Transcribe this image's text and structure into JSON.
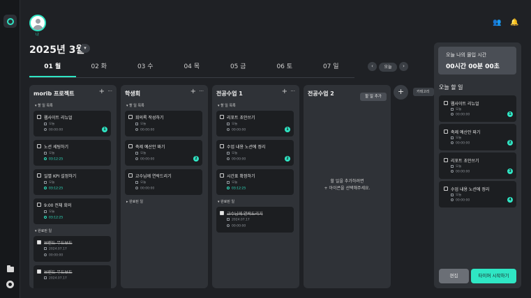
{
  "header": {
    "user_label": "나",
    "month_title": "2025년 3월",
    "month_dropdown_icon": "chevron-down-icon",
    "friends_icon": "users-icon",
    "notification_icon": "bell-icon"
  },
  "week": {
    "days": [
      "01 월",
      "02 화",
      "03 수",
      "04 목",
      "05 금",
      "06 토",
      "07 일"
    ],
    "active_index": 0,
    "prev_icon": "chevron-left-icon",
    "next_icon": "chevron-right-icon",
    "today_label": "오늘"
  },
  "columns": [
    {
      "title": "morib 프로젝트",
      "todo_header": "할 일 목록",
      "todo": [
        {
          "title": "웹사이트 리뉴얼",
          "deadline": "오늘",
          "time": "00:00:00",
          "badge": "1",
          "timer_active": false
        },
        {
          "title": "노션 세팅하기",
          "deadline": "오늘",
          "time": "03:12:25",
          "badge": "",
          "timer_active": true
        },
        {
          "title": "일별 KPI 설정하기",
          "deadline": "오늘",
          "time": "03:12:25",
          "badge": "",
          "timer_active": true
        },
        {
          "title": "9:00 전체 회의",
          "deadline": "오늘",
          "time": "03:12:25",
          "badge": "",
          "timer_active": true
        }
      ],
      "done_header": "완료된 일",
      "done": [
        {
          "title": "브랜드 무드보드",
          "deadline": "2024.07.17",
          "time": "00:00:00"
        },
        {
          "title": "브랜드 무드보드",
          "deadline": "2024.07.17",
          "time": ""
        }
      ]
    },
    {
      "title": "학생회",
      "todo_header": "할 일 목록",
      "todo": [
        {
          "title": "회의록 작성하기",
          "deadline": "오늘",
          "time": "00:00:00",
          "badge": "",
          "timer_active": false
        },
        {
          "title": "축제 예산안 짜기",
          "deadline": "오늘",
          "time": "00:00:00",
          "badge": "2",
          "timer_active": false
        },
        {
          "title": "교수님께 연락드리기",
          "deadline": "오늘",
          "time": "00:00:00",
          "badge": "",
          "timer_active": false
        }
      ],
      "done_header": "완료된 일",
      "done": []
    },
    {
      "title": "전공수업 1",
      "todo_header": "할 일 목록",
      "todo": [
        {
          "title": "리포트 초안쓰기",
          "deadline": "오늘",
          "time": "00:00:00",
          "badge": "1",
          "timer_active": false
        },
        {
          "title": "수업 내용 노션에 정리",
          "deadline": "오늘",
          "time": "00:00:00",
          "badge": "2",
          "timer_active": false
        },
        {
          "title": "시간표 확정하기",
          "deadline": "오늘",
          "time": "03:12:25",
          "badge": "",
          "timer_active": true
        }
      ],
      "done_header": "완료된 일",
      "done": [
        {
          "title": "교수님께 연락드리기",
          "deadline": "2024.07.17",
          "time": "00:00:00"
        }
      ]
    },
    {
      "title": "전공수업 2",
      "add_task_label": "할 일 추가",
      "empty_line1": "할 일을 추가하려면",
      "empty_line2": "+ 아이콘을 선택해주세요."
    }
  ],
  "add_category_tooltip": "카테고리",
  "panel": {
    "focus_label": "오늘 나의 몰입 시간",
    "focus_value": "00시간 00분 00초",
    "today_title": "오늘 할 일",
    "items": [
      {
        "title": "웹사이트 리뉴얼",
        "deadline": "오늘",
        "time": "00:00:00",
        "badge": "1"
      },
      {
        "title": "축제 예산안 짜기",
        "deadline": "오늘",
        "time": "00:00:00",
        "badge": "2"
      },
      {
        "title": "리포트 초안쓰기",
        "deadline": "오늘",
        "time": "00:00:00",
        "badge": "3"
      },
      {
        "title": "수업 내용 노션에 정리",
        "deadline": "오늘",
        "time": "00:00:00",
        "badge": "4"
      }
    ],
    "edit_label": "편집",
    "start_label": "타이머 시작하기"
  },
  "colors": {
    "accent": "#2fe6c4",
    "background": "#1f2125",
    "column": "#2f3237",
    "card": "#1c1e21"
  }
}
